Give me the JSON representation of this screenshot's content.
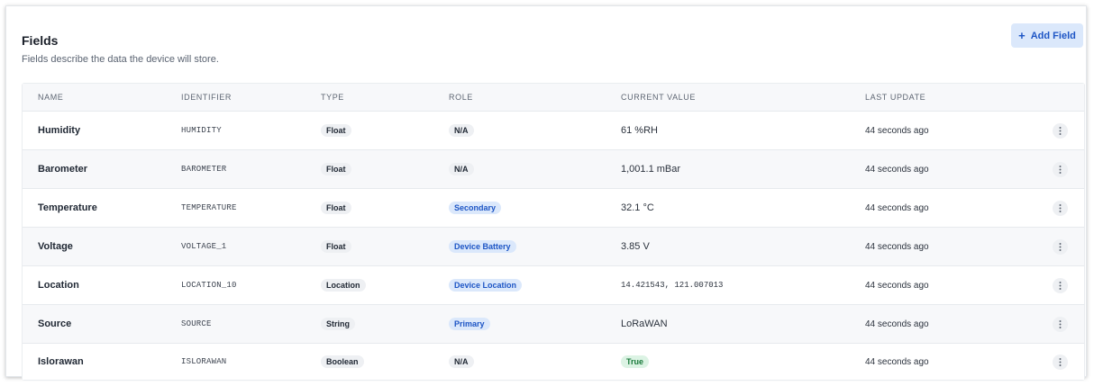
{
  "header": {
    "title": "Fields",
    "subtitle": "Fields describe the data the device will store.",
    "add_button_label": "Add Field",
    "add_button_icon": "plus-icon"
  },
  "table": {
    "columns": [
      "NAME",
      "IDENTIFIER",
      "TYPE",
      "ROLE",
      "CURRENT VALUE",
      "LAST UPDATE"
    ],
    "rows": [
      {
        "name": "Humidity",
        "identifier": "HUMIDITY",
        "type": "Float",
        "role": "N/A",
        "role_style": "gray",
        "value": "61 %RH",
        "value_style": "text",
        "updated": "44 seconds ago"
      },
      {
        "name": "Barometer",
        "identifier": "BAROMETER",
        "type": "Float",
        "role": "N/A",
        "role_style": "gray",
        "value": "1,001.1 mBar",
        "value_style": "text",
        "updated": "44 seconds ago"
      },
      {
        "name": "Temperature",
        "identifier": "TEMPERATURE",
        "type": "Float",
        "role": "Secondary",
        "role_style": "blue",
        "value": "32.1 °C",
        "value_style": "text",
        "updated": "44 seconds ago"
      },
      {
        "name": "Voltage",
        "identifier": "VOLTAGE_1",
        "type": "Float",
        "role": "Device Battery",
        "role_style": "blue",
        "value": "3.85 V",
        "value_style": "text",
        "updated": "44 seconds ago"
      },
      {
        "name": "Location",
        "identifier": "LOCATION_10",
        "type": "Location",
        "role": "Device Location",
        "role_style": "blue",
        "value": "14.421543, 121.007013",
        "value_style": "mono",
        "updated": "44 seconds ago"
      },
      {
        "name": "Source",
        "identifier": "SOURCE",
        "type": "String",
        "role": "Primary",
        "role_style": "blue",
        "value": "LoRaWAN",
        "value_style": "text",
        "updated": "44 seconds ago"
      },
      {
        "name": "Islorawan",
        "identifier": "ISLORAWAN",
        "type": "Boolean",
        "role": "N/A",
        "role_style": "gray",
        "value": "True",
        "value_style": "badge-green",
        "updated": "44 seconds ago"
      }
    ],
    "row_menu_icon": "more-vertical-icon"
  },
  "colors": {
    "accent": "#1d55c5",
    "accent_bg": "#dbe8fb",
    "success": "#1a7a3b",
    "success_bg": "#dcf3e4"
  }
}
